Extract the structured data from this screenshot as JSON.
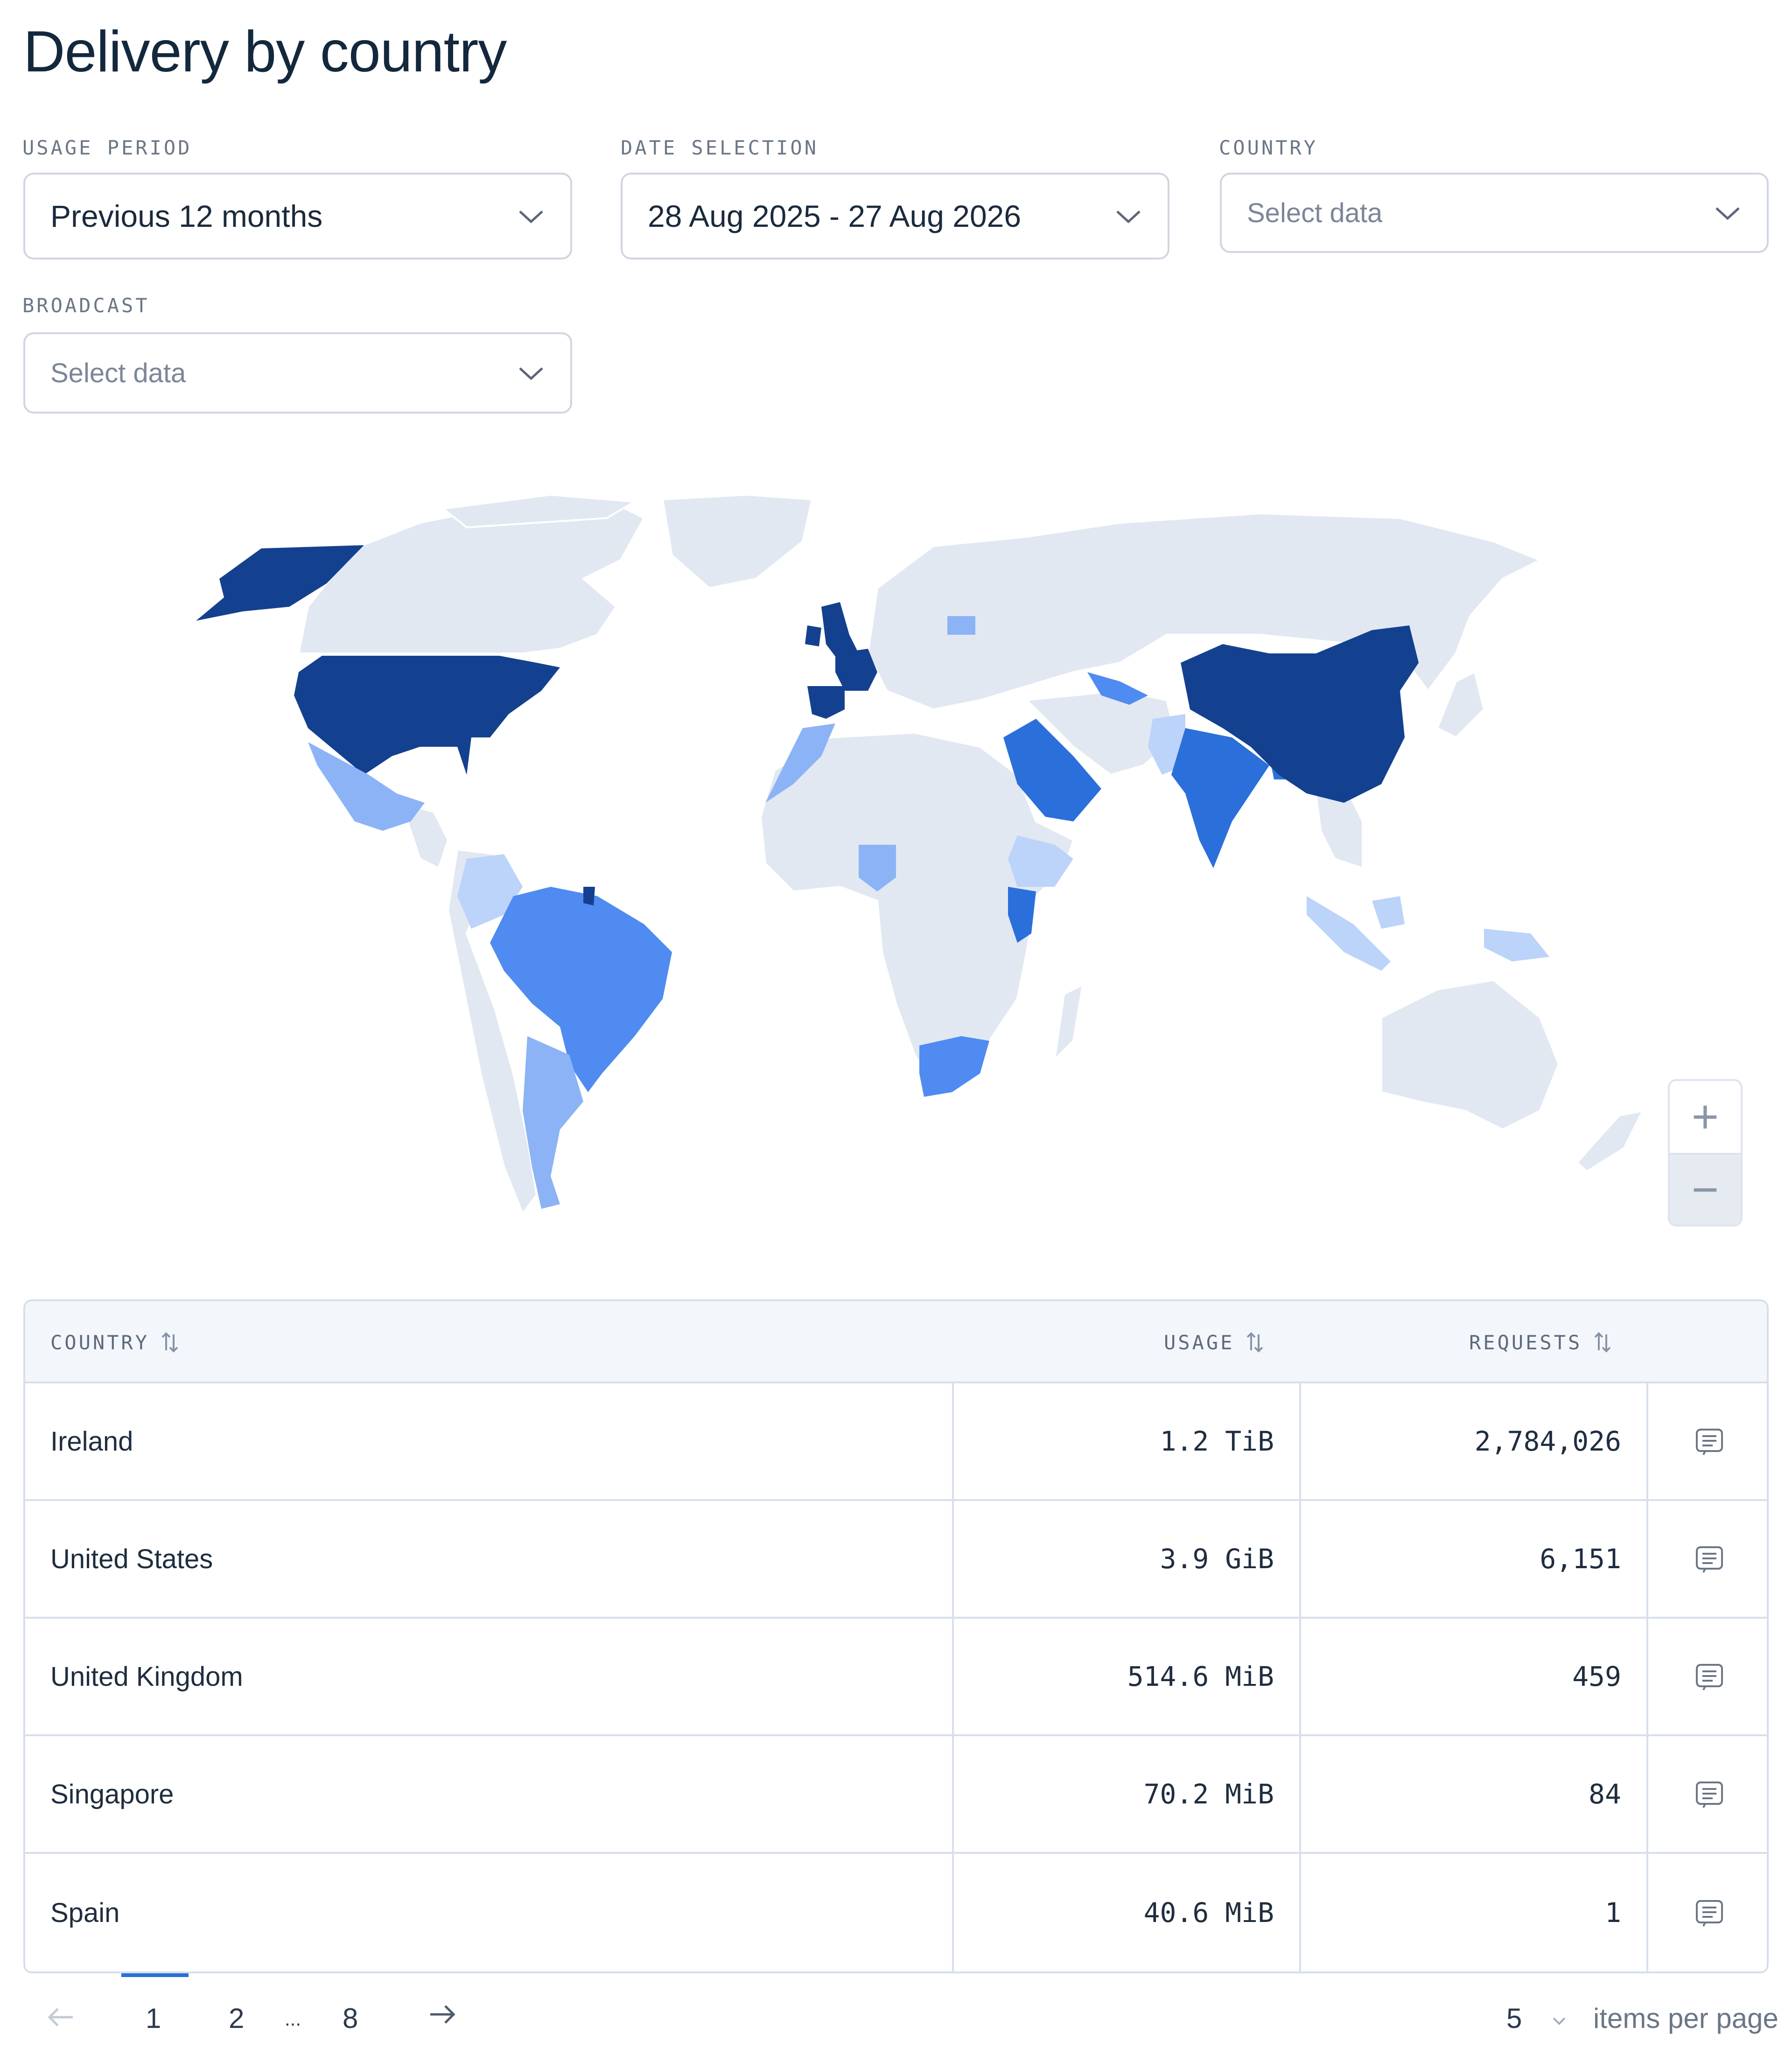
{
  "page": {
    "title": "Delivery by country"
  },
  "filters": {
    "usage_period": {
      "label": "USAGE PERIOD",
      "value": "Previous 12 months"
    },
    "date_selection": {
      "label": "DATE SELECTION",
      "value": "28 Aug 2025 - 27 Aug 2026"
    },
    "country": {
      "label": "COUNTRY",
      "placeholder": "Select data"
    },
    "broadcast": {
      "label": "BROADCAST",
      "placeholder": "Select data"
    }
  },
  "map": {
    "legend_colors": {
      "high": "#14418f",
      "mid_high": "#2b6fdb",
      "mid": "#4f8bf0",
      "low": "#8cb3f5",
      "lowest": "#bcd3fa",
      "none": "#e1e8f2"
    },
    "zoom": {
      "in": "+",
      "out": "−"
    }
  },
  "table": {
    "columns": {
      "country": "COUNTRY",
      "usage": "USAGE",
      "requests": "REQUESTS"
    },
    "rows": [
      {
        "country": "Ireland",
        "usage": "1.2 TiB",
        "requests": "2,784,026"
      },
      {
        "country": "United States",
        "usage": "3.9 GiB",
        "requests": "6,151"
      },
      {
        "country": "United Kingdom",
        "usage": "514.6 MiB",
        "requests": "459"
      },
      {
        "country": "Singapore",
        "usage": "70.2 MiB",
        "requests": "84"
      },
      {
        "country": "Spain",
        "usage": "40.6 MiB",
        "requests": "1"
      }
    ]
  },
  "pagination": {
    "pages": [
      "1",
      "2",
      "...",
      "8"
    ],
    "current": "1",
    "items_per_page": "5",
    "items_per_page_label": "items per page"
  }
}
